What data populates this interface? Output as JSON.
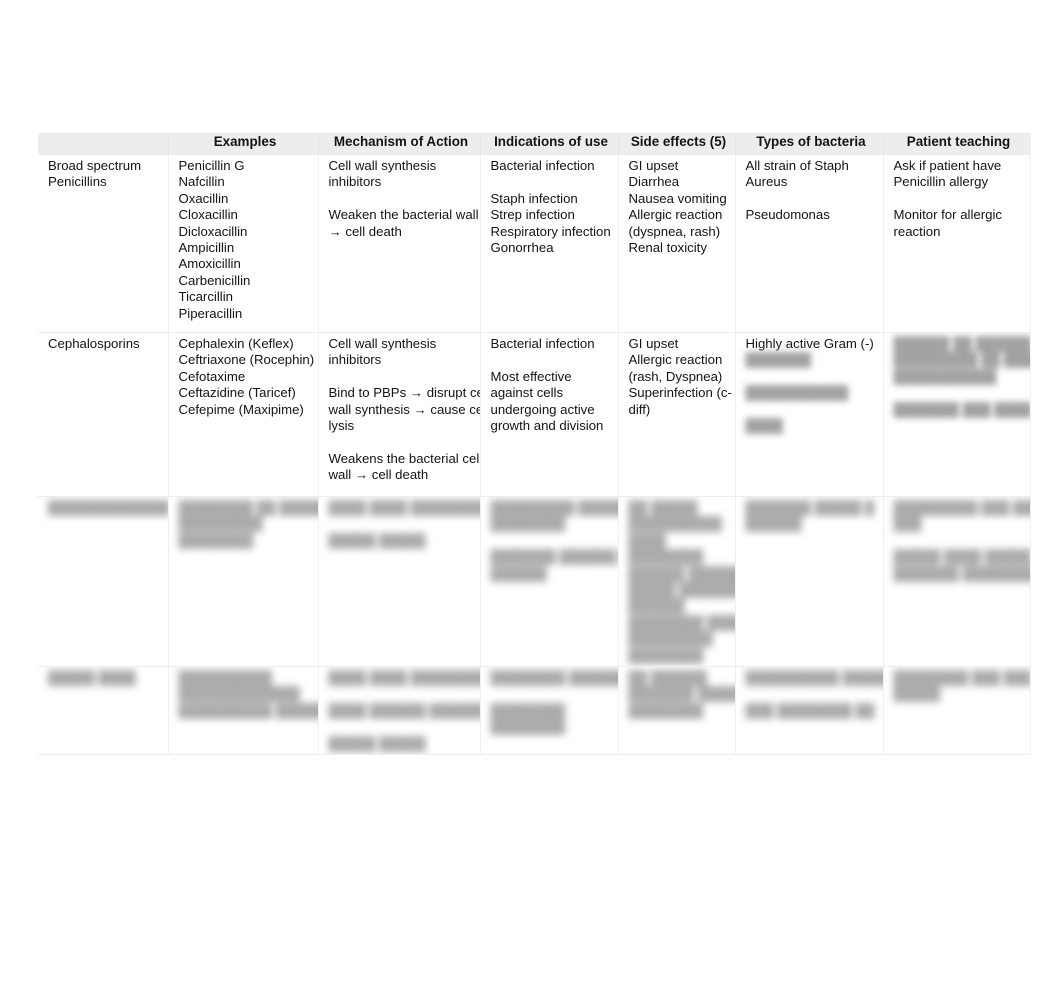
{
  "document": {
    "type": "antibiotics-comparison-table",
    "background_color": "#ffffff",
    "header_background_color": "#ededed",
    "text_color": "#141414",
    "border_color": "#f0f0f0"
  },
  "table": {
    "columns": [
      {
        "key": "category",
        "label": ""
      },
      {
        "key": "examples",
        "label": "Examples"
      },
      {
        "key": "mechanism",
        "label": "Mechanism of Action"
      },
      {
        "key": "indications",
        "label": "Indications of use"
      },
      {
        "key": "side_effects",
        "label": "Side effects (5)"
      },
      {
        "key": "bacteria",
        "label": "Types of bacteria"
      },
      {
        "key": "teaching",
        "label": "Patient teaching"
      }
    ],
    "rows": [
      {
        "id": "row-penicillins",
        "redacted": false,
        "category": [
          "Broad spectrum",
          "Penicillins"
        ],
        "examples": [
          "Penicillin G",
          "Nafcillin",
          "Oxacillin",
          "Cloxacillin",
          "Dicloxacillin",
          "Ampicillin",
          "Amoxicillin",
          "Carbenicillin",
          "Ticarcillin",
          "Piperacillin"
        ],
        "mechanism": [
          "Cell wall synthesis",
          "inhibitors",
          "",
          "Weaken the bacterial wall",
          "→ cell death"
        ],
        "indications": [
          "Bacterial infection",
          "",
          "Staph infection",
          "Strep infection",
          "Respiratory infection",
          "Gonorrhea"
        ],
        "side_effects": [
          "GI upset",
          "Diarrhea",
          "Nausea vomiting",
          "Allergic reaction",
          "(dyspnea, rash)",
          "Renal toxicity"
        ],
        "bacteria": [
          "All strain of Staph",
          "Aureus",
          "",
          "Pseudomonas"
        ],
        "teaching": [
          "Ask if patient have",
          "Penicillin allergy",
          "",
          "Monitor for allergic",
          "reaction"
        ]
      },
      {
        "id": "row-cephalosporins",
        "redacted": false,
        "category": [
          "Cephalosporins"
        ],
        "examples": [
          "Cephalexin (Keflex)",
          "Ceftriaxone (Rocephin)",
          "Cefotaxime",
          "Ceftazidine (Taricef)",
          "Cefepime (Maxipime)"
        ],
        "mechanism": [
          "Cell wall synthesis",
          "inhibitors",
          "",
          "Bind to PBPs → disrupt cell",
          "wall synthesis → cause cell",
          "lysis",
          "",
          "Weakens the bacterial cell",
          "wall → cell death"
        ],
        "indications": [
          "Bacterial infection",
          "",
          "Most effective",
          "against cells",
          "undergoing active",
          "growth and division"
        ],
        "side_effects": [
          "GI upset",
          "Allergic reaction",
          "(rash, Dyspnea)",
          "Superinfection (c-",
          "diff)"
        ],
        "bacteria": [
          "Highly active Gram (-)"
        ],
        "bacteria_redacted": [
          "███████",
          "",
          "███████████",
          "",
          "████"
        ],
        "teaching": [],
        "teaching_redacted": [
          "██████ ██ ██████ ███",
          "█████████ ██ █████████",
          "███████████",
          "",
          "███████ ███ ████"
        ]
      },
      {
        "id": "row-redacted-3",
        "redacted": true,
        "category_redacted": [
          "█████████████"
        ],
        "examples_redacted": [
          "████████ ██ ███████████",
          "█████████",
          "████████"
        ],
        "mechanism_redacted": [
          "████ ████ █████████",
          "",
          "█████ █████"
        ],
        "indications_redacted": [
          "█████████ ████████",
          "████████",
          "",
          "███████ ██████ █",
          "██████"
        ],
        "side_effects_redacted": [
          "██ █████",
          "██████████",
          "████",
          "████████",
          "██████ ████████",
          "█████ ███████",
          "██████",
          "████████ ██████",
          "█████████",
          "████████"
        ],
        "bacteria_redacted": [
          "███████ █████ █",
          "██████"
        ],
        "teaching_redacted": [
          "█████████ ███ ██████",
          "███",
          "",
          "█████ ████ █████",
          "███████ █████████"
        ]
      },
      {
        "id": "row-redacted-4",
        "redacted": true,
        "category_redacted": [
          "█████ ████"
        ],
        "examples_redacted": [
          "██████████",
          "█████████████",
          "██████████ ███████"
        ],
        "mechanism_redacted": [
          "████ ████ █████████",
          "",
          "████ ██████ ██████",
          "",
          "█████ █████"
        ],
        "indications_redacted": [
          "████████ ████████",
          "",
          "████████",
          "████████"
        ],
        "side_effects_redacted": [
          "██ ██████",
          "███████ ███████",
          "████████"
        ],
        "bacteria_redacted": [
          "██████████ ██████",
          "",
          "███ ████████ ██"
        ],
        "teaching_redacted": [
          "████████ ███ ███",
          "█████"
        ]
      }
    ]
  }
}
